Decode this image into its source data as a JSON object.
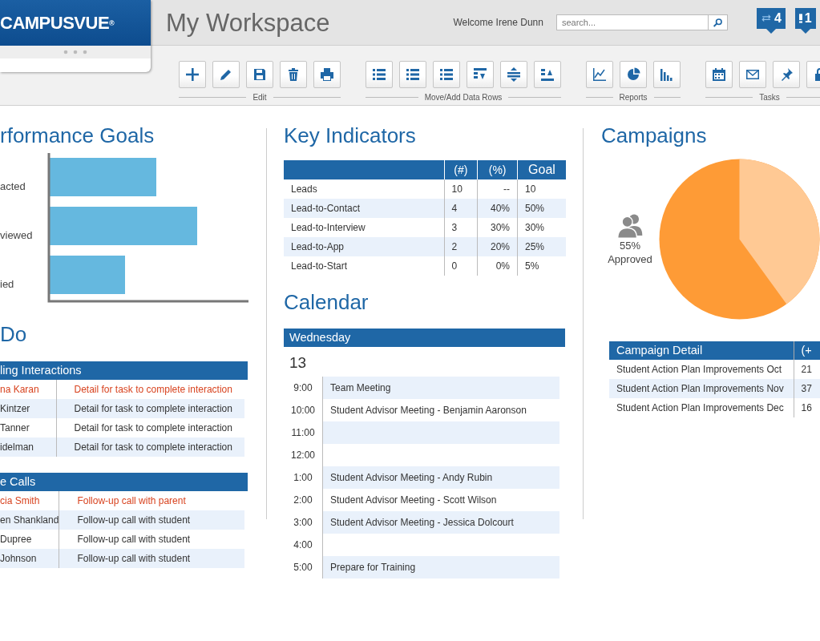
{
  "header": {
    "logo": "CAMPUSVUE",
    "logo_mark": "®",
    "title": "My Workspace",
    "welcome": "Welcome Irene Dunn",
    "search": {
      "placeholder": "search..."
    },
    "badges": [
      {
        "kind": "sync",
        "count": "4"
      },
      {
        "kind": "alert",
        "count": "1"
      }
    ]
  },
  "toolbar": [
    {
      "label": "Edit",
      "buttons": [
        {
          "kind": "add"
        },
        {
          "kind": "edit"
        },
        {
          "kind": "save"
        },
        {
          "kind": "delete"
        },
        {
          "kind": "print"
        }
      ]
    },
    {
      "label": "Move/Add Data Rows",
      "buttons": [
        {
          "kind": "list"
        },
        {
          "kind": "list"
        },
        {
          "kind": "list"
        },
        {
          "kind": "movedown"
        },
        {
          "kind": "moveboth"
        },
        {
          "kind": "moveup"
        }
      ]
    },
    {
      "label": "Reports",
      "buttons": [
        {
          "kind": "linechart"
        },
        {
          "kind": "piechart"
        },
        {
          "kind": "barchart"
        }
      ]
    },
    {
      "label": "Tasks",
      "buttons": [
        {
          "kind": "calendar"
        },
        {
          "kind": "mail"
        },
        {
          "kind": "pin"
        },
        {
          "kind": "lock"
        }
      ]
    }
  ],
  "performance_goals": {
    "title": "rformance Goals",
    "categories": [
      "acted",
      "viewed",
      "ied"
    ]
  },
  "todo": {
    "title": "Do",
    "sections": [
      {
        "title": "ling Interactions",
        "rows": [
          {
            "name": "na Karan",
            "detail": "Detail for task to complete interaction",
            "flagged": true
          },
          {
            "name": "Kintzer",
            "detail": "Detail for task to complete interaction",
            "flagged": false
          },
          {
            "name": "Tanner",
            "detail": "Detail for task to complete interaction",
            "flagged": false
          },
          {
            "name": "idelman",
            "detail": "Detail for task to complete interaction",
            "flagged": false
          }
        ]
      },
      {
        "title": "e Calls",
        "rows": [
          {
            "name": "cia Smith",
            "detail": "Follow-up call with parent",
            "flagged": true
          },
          {
            "name": "en Shankland",
            "detail": "Follow-up call with student",
            "flagged": false
          },
          {
            "name": "Dupree",
            "detail": "Follow-up call with student",
            "flagged": false
          },
          {
            "name": "Johnson",
            "detail": "Follow-up call with student",
            "flagged": false
          }
        ]
      }
    ]
  },
  "key_indicators": {
    "title": "Key Indicators",
    "columns": [
      "",
      "(#)",
      "(%)",
      "Goal"
    ],
    "rows": [
      [
        "Leads",
        "10",
        "--",
        "10"
      ],
      [
        "Lead-to-Contact",
        "4",
        "40%",
        "50%"
      ],
      [
        "Lead-to-Interview",
        "3",
        "30%",
        "30%"
      ],
      [
        "Lead-to-App",
        "2",
        "20%",
        "25%"
      ],
      [
        "Lead-to-Start",
        "0",
        "0%",
        "5%"
      ]
    ]
  },
  "calendar": {
    "title": "Calendar",
    "weekday": "Wednesday",
    "day": "13",
    "slots": [
      {
        "time": "9:00",
        "event": "Team Meeting"
      },
      {
        "time": "10:00",
        "event": "Student Advisor Meeting - Benjamin Aaronson"
      },
      {
        "time": "11:00"
      },
      {
        "time": "12:00"
      },
      {
        "time": "1:00",
        "event": "Student Advisor Meeting - Andy Rubin"
      },
      {
        "time": "2:00",
        "event": "Student Advisor Meeting - Scott Wilson"
      },
      {
        "time": "3:00",
        "event": "Student Advisor Meeting - Jessica Dolcourt"
      },
      {
        "time": "4:00"
      },
      {
        "time": "5:00",
        "event": "Prepare for Training"
      }
    ]
  },
  "campaigns": {
    "title": "Campaigns",
    "approved_percent": "55%",
    "approved_label": "Approved",
    "detail": {
      "columns": [
        "Campaign Detail",
        "(+"
      ],
      "rows": [
        [
          "Student Action Plan Improvements Oct",
          "21"
        ],
        [
          "Student Action Plan Improvements Nov",
          "37"
        ],
        [
          "Student Action Plan Improvements Dec",
          "16"
        ]
      ]
    }
  }
}
